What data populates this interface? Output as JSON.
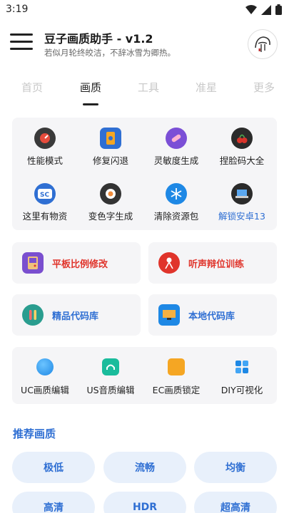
{
  "status_bar": {
    "time": "3:19"
  },
  "header": {
    "title": "豆子画质助手 - v1.2",
    "subtitle": "若似月轮终皎洁，不辞冰雪为卿热。"
  },
  "tabs": [
    "首页",
    "画质",
    "工具",
    "准星",
    "更多"
  ],
  "grid": [
    {
      "label": "性能模式",
      "icon": "speedometer-icon"
    },
    {
      "label": "修复闪退",
      "icon": "phone-repair-icon"
    },
    {
      "label": "灵敏度生成",
      "icon": "pills-icon"
    },
    {
      "label": "捏脸码大全",
      "icon": "cherries-icon"
    },
    {
      "label": "这里有物资",
      "icon": "sc-badge-icon"
    },
    {
      "label": "变色字生成",
      "icon": "sushi-icon"
    },
    {
      "label": "清除资源包",
      "icon": "snowflake-icon"
    },
    {
      "label": "解锁安卓13",
      "icon": "laptop-icon"
    }
  ],
  "cards": {
    "tablet_ratio": "平板比例修改",
    "audio_training": "听声辩位训练",
    "premium_code": "精品代码库",
    "local_code": "本地代码库"
  },
  "tools": [
    {
      "label": "UC画质编辑",
      "icon": "blue-dot-icon"
    },
    {
      "label": "US音质编辑",
      "icon": "headphones-icon"
    },
    {
      "label": "EC画质锁定",
      "icon": "orange-lock-icon"
    },
    {
      "label": "DIY可视化",
      "icon": "blue-puzzle-icon"
    }
  ],
  "recommend": {
    "title": "推荐画质",
    "options": [
      "极低",
      "流畅",
      "均衡",
      "高清",
      "HDR",
      "超高清"
    ]
  }
}
